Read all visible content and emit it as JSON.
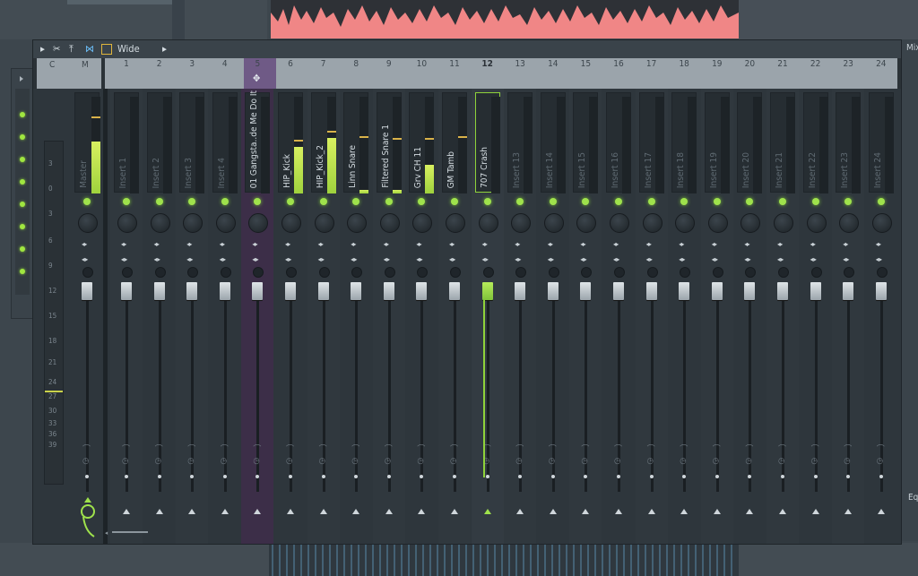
{
  "titlebar": {
    "mode_label": "Wide",
    "icons": [
      "arrow-right-icon",
      "cut-icon",
      "upload-icon",
      "route-icon",
      "panel-icon",
      "chevron-right-icon"
    ]
  },
  "side_panel": {
    "arrow_icon": "arrow-right-icon",
    "led_count": 8
  },
  "mixer": {
    "header": [
      "C",
      "M",
      "1",
      "2",
      "3",
      "4",
      "5",
      "6",
      "7",
      "8",
      "9",
      "10",
      "11",
      "12",
      "13",
      "14",
      "15",
      "16",
      "17",
      "18",
      "19",
      "20",
      "21",
      "22",
      "23",
      "24"
    ],
    "master_name": "Master",
    "tracks": [
      {
        "num": "1",
        "name": "Insert 1"
      },
      {
        "num": "2",
        "name": "Insert 2"
      },
      {
        "num": "3",
        "name": "Insert 3"
      },
      {
        "num": "4",
        "name": "Insert 4"
      },
      {
        "num": "5",
        "name": "01 Gangsta..de Me Do It"
      },
      {
        "num": "6",
        "name": "HIP_Kick"
      },
      {
        "num": "7",
        "name": "HIP_Kick_2"
      },
      {
        "num": "8",
        "name": "Linn Snare"
      },
      {
        "num": "9",
        "name": "Filtered Snare 1"
      },
      {
        "num": "10",
        "name": "Grv CH 11"
      },
      {
        "num": "11",
        "name": "GM Tamb"
      },
      {
        "num": "12",
        "name": "707 Crash"
      },
      {
        "num": "13",
        "name": "Insert 13"
      },
      {
        "num": "14",
        "name": "Insert 14"
      },
      {
        "num": "15",
        "name": "Insert 15"
      },
      {
        "num": "16",
        "name": "Insert 16"
      },
      {
        "num": "17",
        "name": "Insert 17"
      },
      {
        "num": "18",
        "name": "Insert 18"
      },
      {
        "num": "19",
        "name": "Insert 19"
      },
      {
        "num": "20",
        "name": "Insert 20"
      },
      {
        "num": "21",
        "name": "Insert 21"
      },
      {
        "num": "22",
        "name": "Insert 22"
      },
      {
        "num": "23",
        "name": "Insert 23"
      },
      {
        "num": "24",
        "name": "Insert 24"
      }
    ],
    "db_scale": [
      "3",
      "0",
      "3",
      "6",
      "9",
      "12",
      "15",
      "18",
      "21",
      "24",
      "27",
      "30",
      "33",
      "36",
      "39"
    ],
    "selected_track": "12",
    "accent_color": "#9fe24c",
    "highlight_track_color": "#3c2e48"
  },
  "right_window": {
    "top_label": "Mix",
    "eq_label": "Eq"
  }
}
